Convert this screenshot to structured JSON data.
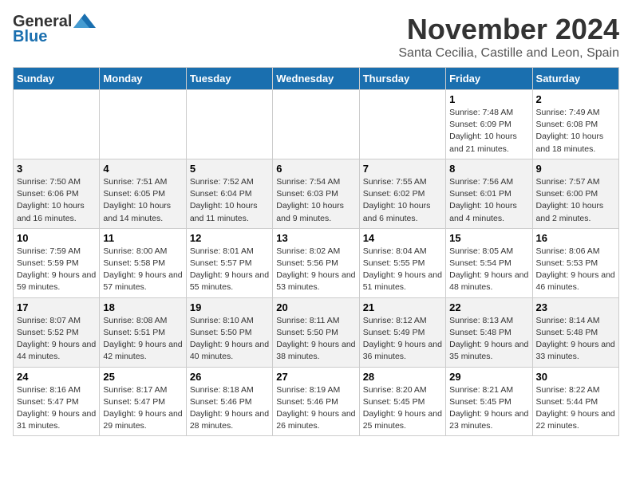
{
  "header": {
    "logo_line1": "General",
    "logo_line2": "Blue",
    "month": "November 2024",
    "location": "Santa Cecilia, Castille and Leon, Spain"
  },
  "weekdays": [
    "Sunday",
    "Monday",
    "Tuesday",
    "Wednesday",
    "Thursday",
    "Friday",
    "Saturday"
  ],
  "weeks": [
    [
      {
        "day": "",
        "info": ""
      },
      {
        "day": "",
        "info": ""
      },
      {
        "day": "",
        "info": ""
      },
      {
        "day": "",
        "info": ""
      },
      {
        "day": "",
        "info": ""
      },
      {
        "day": "1",
        "info": "Sunrise: 7:48 AM\nSunset: 6:09 PM\nDaylight: 10 hours and 21 minutes."
      },
      {
        "day": "2",
        "info": "Sunrise: 7:49 AM\nSunset: 6:08 PM\nDaylight: 10 hours and 18 minutes."
      }
    ],
    [
      {
        "day": "3",
        "info": "Sunrise: 7:50 AM\nSunset: 6:06 PM\nDaylight: 10 hours and 16 minutes."
      },
      {
        "day": "4",
        "info": "Sunrise: 7:51 AM\nSunset: 6:05 PM\nDaylight: 10 hours and 14 minutes."
      },
      {
        "day": "5",
        "info": "Sunrise: 7:52 AM\nSunset: 6:04 PM\nDaylight: 10 hours and 11 minutes."
      },
      {
        "day": "6",
        "info": "Sunrise: 7:54 AM\nSunset: 6:03 PM\nDaylight: 10 hours and 9 minutes."
      },
      {
        "day": "7",
        "info": "Sunrise: 7:55 AM\nSunset: 6:02 PM\nDaylight: 10 hours and 6 minutes."
      },
      {
        "day": "8",
        "info": "Sunrise: 7:56 AM\nSunset: 6:01 PM\nDaylight: 10 hours and 4 minutes."
      },
      {
        "day": "9",
        "info": "Sunrise: 7:57 AM\nSunset: 6:00 PM\nDaylight: 10 hours and 2 minutes."
      }
    ],
    [
      {
        "day": "10",
        "info": "Sunrise: 7:59 AM\nSunset: 5:59 PM\nDaylight: 9 hours and 59 minutes."
      },
      {
        "day": "11",
        "info": "Sunrise: 8:00 AM\nSunset: 5:58 PM\nDaylight: 9 hours and 57 minutes."
      },
      {
        "day": "12",
        "info": "Sunrise: 8:01 AM\nSunset: 5:57 PM\nDaylight: 9 hours and 55 minutes."
      },
      {
        "day": "13",
        "info": "Sunrise: 8:02 AM\nSunset: 5:56 PM\nDaylight: 9 hours and 53 minutes."
      },
      {
        "day": "14",
        "info": "Sunrise: 8:04 AM\nSunset: 5:55 PM\nDaylight: 9 hours and 51 minutes."
      },
      {
        "day": "15",
        "info": "Sunrise: 8:05 AM\nSunset: 5:54 PM\nDaylight: 9 hours and 48 minutes."
      },
      {
        "day": "16",
        "info": "Sunrise: 8:06 AM\nSunset: 5:53 PM\nDaylight: 9 hours and 46 minutes."
      }
    ],
    [
      {
        "day": "17",
        "info": "Sunrise: 8:07 AM\nSunset: 5:52 PM\nDaylight: 9 hours and 44 minutes."
      },
      {
        "day": "18",
        "info": "Sunrise: 8:08 AM\nSunset: 5:51 PM\nDaylight: 9 hours and 42 minutes."
      },
      {
        "day": "19",
        "info": "Sunrise: 8:10 AM\nSunset: 5:50 PM\nDaylight: 9 hours and 40 minutes."
      },
      {
        "day": "20",
        "info": "Sunrise: 8:11 AM\nSunset: 5:50 PM\nDaylight: 9 hours and 38 minutes."
      },
      {
        "day": "21",
        "info": "Sunrise: 8:12 AM\nSunset: 5:49 PM\nDaylight: 9 hours and 36 minutes."
      },
      {
        "day": "22",
        "info": "Sunrise: 8:13 AM\nSunset: 5:48 PM\nDaylight: 9 hours and 35 minutes."
      },
      {
        "day": "23",
        "info": "Sunrise: 8:14 AM\nSunset: 5:48 PM\nDaylight: 9 hours and 33 minutes."
      }
    ],
    [
      {
        "day": "24",
        "info": "Sunrise: 8:16 AM\nSunset: 5:47 PM\nDaylight: 9 hours and 31 minutes."
      },
      {
        "day": "25",
        "info": "Sunrise: 8:17 AM\nSunset: 5:47 PM\nDaylight: 9 hours and 29 minutes."
      },
      {
        "day": "26",
        "info": "Sunrise: 8:18 AM\nSunset: 5:46 PM\nDaylight: 9 hours and 28 minutes."
      },
      {
        "day": "27",
        "info": "Sunrise: 8:19 AM\nSunset: 5:46 PM\nDaylight: 9 hours and 26 minutes."
      },
      {
        "day": "28",
        "info": "Sunrise: 8:20 AM\nSunset: 5:45 PM\nDaylight: 9 hours and 25 minutes."
      },
      {
        "day": "29",
        "info": "Sunrise: 8:21 AM\nSunset: 5:45 PM\nDaylight: 9 hours and 23 minutes."
      },
      {
        "day": "30",
        "info": "Sunrise: 8:22 AM\nSunset: 5:44 PM\nDaylight: 9 hours and 22 minutes."
      }
    ]
  ]
}
